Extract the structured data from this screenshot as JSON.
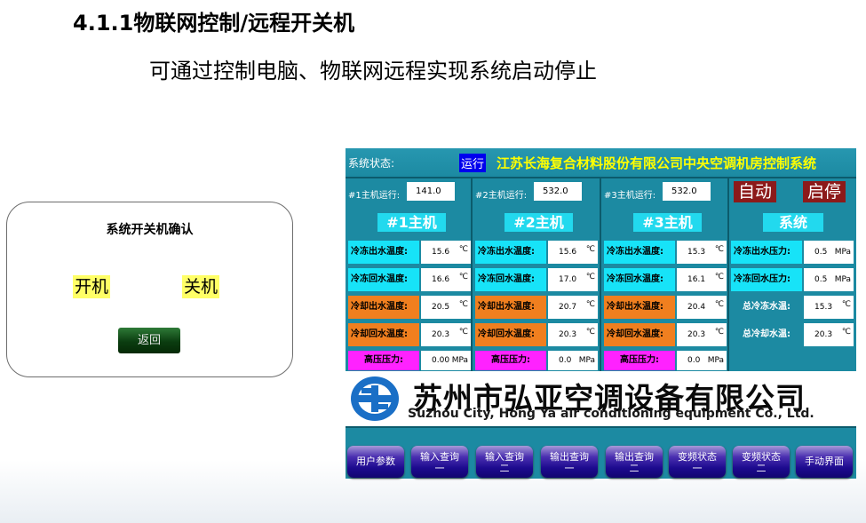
{
  "title": "4.1.1物联网控制/远程开关机",
  "subtitle": "可通过控制电脑、物联网远程实现系统启动停止",
  "dialog": {
    "title": "系统开关机确认",
    "on": "开机",
    "off": "关机",
    "back": "返回"
  },
  "hmi": {
    "status_label": "系统状态:",
    "status": "运行",
    "system_title": "江苏长海复合材料股份有限公司中央空调机房控制系统",
    "units": [
      {
        "run_label": "#1主机运行:",
        "run_value": "141.0",
        "head": "#1主机",
        "rows": [
          {
            "label": "冷冻出水温度:",
            "value": "15.6",
            "unit": "℃"
          },
          {
            "label": "冷冻回水温度:",
            "value": "16.6",
            "unit": "℃"
          },
          {
            "label": "冷却出水温度:",
            "value": "20.5",
            "unit": "℃"
          },
          {
            "label": "冷却回水温度:",
            "value": "20.3",
            "unit": "℃"
          },
          {
            "label": "高压压力:",
            "value": "0.00",
            "unit": "MPa"
          }
        ]
      },
      {
        "run_label": "#2主机运行:",
        "run_value": "532.0",
        "head": "#2主机",
        "rows": [
          {
            "label": "冷冻出水温度:",
            "value": "15.6",
            "unit": "℃"
          },
          {
            "label": "冷冻回水温度:",
            "value": "17.0",
            "unit": "℃"
          },
          {
            "label": "冷却出水温度:",
            "value": "20.7",
            "unit": "℃"
          },
          {
            "label": "冷却回水温度:",
            "value": "20.3",
            "unit": "℃"
          },
          {
            "label": "高压压力:",
            "value": "0.0",
            "unit": "MPa"
          }
        ]
      },
      {
        "run_label": "#3主机运行:",
        "run_value": "532.0",
        "head": "#3主机",
        "rows": [
          {
            "label": "冷冻出水温度:",
            "value": "15.3",
            "unit": "℃"
          },
          {
            "label": "冷冻回水温度:",
            "value": "16.1",
            "unit": "℃"
          },
          {
            "label": "冷却出水温度:",
            "value": "20.4",
            "unit": "℃"
          },
          {
            "label": "冷却回水温度:",
            "value": "20.3",
            "unit": "℃"
          },
          {
            "label": "高压压力:",
            "value": "0.0",
            "unit": "MPa"
          }
        ]
      }
    ],
    "system": {
      "auto": "自动",
      "start_stop": "启停",
      "head": "系统",
      "rows": [
        {
          "label": "冷冻出水压力:",
          "value": "0.5",
          "unit": "MPa"
        },
        {
          "label": "冷冻回水压力:",
          "value": "0.5",
          "unit": "MPa"
        },
        {
          "label": "总冷冻水温:",
          "value": "15.3",
          "unit": "℃"
        },
        {
          "label": "总冷却水温:",
          "value": "20.3",
          "unit": "℃"
        }
      ]
    },
    "logo": {
      "cn": "苏州市弘亚空调设备有限公司",
      "en": "Suzhou City, Hong Ya air conditioning equipment Co., Ltd."
    }
  },
  "nav": [
    {
      "l1": "用户参数",
      "l2": ""
    },
    {
      "l1": "输入查询",
      "l2": "一"
    },
    {
      "l1": "输入查询",
      "l2": "二"
    },
    {
      "l1": "输出查询",
      "l2": "一"
    },
    {
      "l1": "输出查询",
      "l2": "二"
    },
    {
      "l1": "变频状态",
      "l2": "一"
    },
    {
      "l1": "变频状态",
      "l2": "二"
    },
    {
      "l1": "手动界面",
      "l2": ""
    }
  ]
}
